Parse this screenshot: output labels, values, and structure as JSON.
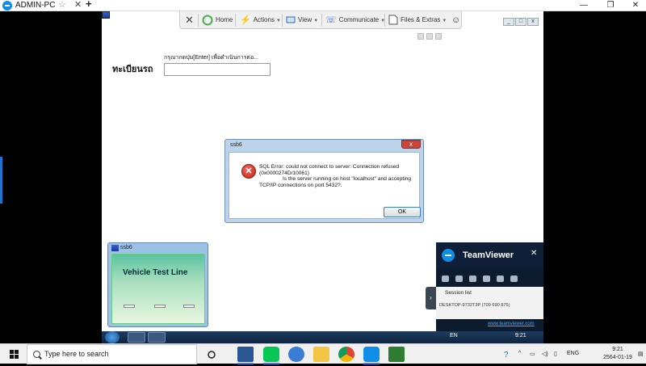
{
  "outer": {
    "tab_title": "ADMIN-PC",
    "star_icon": "star-icon",
    "close_tab_icon": "close-icon",
    "add_tab_icon": "plus-icon"
  },
  "toolbar": {
    "home": "Home",
    "actions": "Actions",
    "view": "View",
    "communicate": "Communicate",
    "files": "Files & Extras"
  },
  "form": {
    "hint": "กรุณากดปุ่ม[Enter] เพื่อดำเนินการต่อ...",
    "label": "ทะเบียนรถ",
    "value": ""
  },
  "dialog": {
    "title": "ssb6",
    "close": "x",
    "line1": "SQL Error: could not connect to server: Connection refused",
    "line2": "(0x0000274D/10061)",
    "line3": "Is the server running on host \"localhost\" and accepting",
    "line4": "TCP/IP connections on port 5432?.",
    "ok": "OK",
    "icon": "error-icon"
  },
  "ssb_window": {
    "title": "ssb6",
    "heading": "Vehicle Test Line"
  },
  "tv_panel": {
    "brand": "TeamViewer",
    "close": "✕",
    "session_title": "Session list",
    "session_item": "DESKTOP-9732T3P (709 690 875)",
    "link": "www.teamviewer.com"
  },
  "remote_taskbar": {
    "lang": "EN",
    "time": "9:21"
  },
  "taskbar": {
    "search_placeholder": "Type here to search",
    "lang": "ENG",
    "time": "9:21",
    "date": "2564-01-19"
  },
  "colors": {
    "teamviewer_blue": "#0e8ee9",
    "error_red": "#c3241a"
  }
}
